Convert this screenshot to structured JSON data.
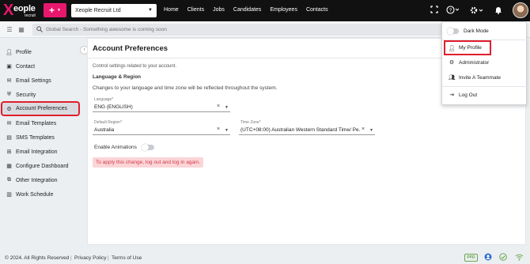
{
  "brand": {
    "logo_x": "X",
    "logo_word": "eople",
    "logo_sub": "recruit"
  },
  "header": {
    "add_label": "+",
    "company": "Xeople Recruit Ltd",
    "nav": [
      "Home",
      "Clients",
      "Jobs",
      "Candidates",
      "Employees",
      "Contacts"
    ],
    "icons": [
      "fullscreen-icon",
      "help-icon",
      "settings-icon",
      "notifications-icon",
      "avatar"
    ]
  },
  "toolbar": {
    "search_placeholder": "Global Search - Something awesome is coming soon"
  },
  "sidebar": {
    "items": [
      {
        "label": "Profile",
        "icon": "person-icon"
      },
      {
        "label": "Contact",
        "icon": "contact-card-icon"
      },
      {
        "label": "Email Settings",
        "icon": "envelope-icon"
      },
      {
        "label": "Security",
        "icon": "shield-icon"
      },
      {
        "label": "Account Preferences",
        "icon": "account-prefs-icon",
        "active": true
      },
      {
        "label": "Email Templates",
        "icon": "envelope-icon"
      },
      {
        "label": "SMS Templates",
        "icon": "sms-icon"
      },
      {
        "label": "Email Integration",
        "icon": "integration-icon"
      },
      {
        "label": "Configure Dashboard",
        "icon": "dashboard-icon"
      },
      {
        "label": "Other Integration",
        "icon": "link-icon"
      },
      {
        "label": "Work Schedule",
        "icon": "calendar-icon"
      }
    ]
  },
  "main": {
    "title": "Account Preferences",
    "subtitle": "Control settings related to your account.",
    "section_title": "Language & Region",
    "section_desc": "Changes to your language and time zone will be reflected throughout the system.",
    "language": {
      "label": "Language*",
      "value": "ENG (ENGLISH)"
    },
    "region": {
      "label": "Default Region*",
      "value": "Australia"
    },
    "timezone": {
      "label": "Time Zone*",
      "value": "(UTC+08:00) Australian Western Standard Time/ Pe..."
    },
    "animations_label": "Enable Animations",
    "animations_on": false,
    "alert": "To apply this change, log out and log in again."
  },
  "menu": {
    "dark_mode": "Dark Mode",
    "dark_mode_on": false,
    "items": [
      "My Profile",
      "Administrator",
      "Invite A Teammate"
    ],
    "logout": "Log Out"
  },
  "footer": {
    "copyright": "© 2024. All Rights Reserved",
    "privacy": "Privacy Policy",
    "terms": "Terms of Use",
    "separator": "|",
    "badge": "PPD"
  },
  "colors": {
    "brand_pink": "#e8176e",
    "highlight_red": "#e01e2d",
    "alert_bg": "#fbd5d8",
    "alert_text": "#d43a45"
  }
}
